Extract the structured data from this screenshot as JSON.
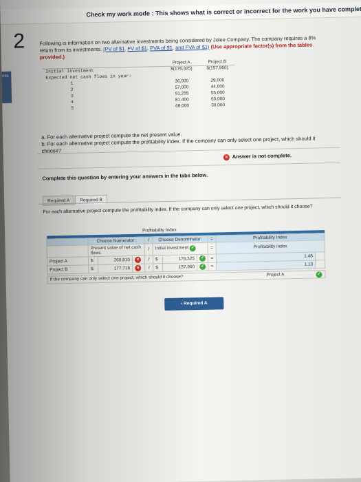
{
  "banner": {
    "text": "Check my work mode : This shows what is correct or incorrect for the work you have completed so far. It does not i"
  },
  "question": {
    "number": "2",
    "side_tab": "ints",
    "intro_text": "Following is information on two alternative investments being considered by Jolee Company. The company requires a 8% return from its investments.",
    "links": [
      "(PV of $1",
      "FV of $1",
      "PVA of $1",
      "and FVA of $1)"
    ],
    "instruction": "(Use appropriate factor(s) from the tables provided.)"
  },
  "investments": {
    "headers": [
      "",
      "Project A",
      "Project B"
    ],
    "rows": [
      {
        "label": "Initial investment",
        "a": "$(176,325)",
        "b": "$(157,960)"
      },
      {
        "label": "Expected net cash flows in year:",
        "a": "",
        "b": ""
      },
      {
        "label": "1",
        "a": "36,000",
        "b": "28,000"
      },
      {
        "label": "2",
        "a": "57,000",
        "b": "44,000"
      },
      {
        "label": "3",
        "a": "91,255",
        "b": "55,000"
      },
      {
        "label": "4",
        "a": "81,400",
        "b": "60,000"
      },
      {
        "label": "5",
        "a": "68,000",
        "b": "30,000"
      }
    ]
  },
  "parts": [
    "a. For each alternative project compute the net present value.",
    "b. For each alternative project compute the profitability index. If the company can only select one project, which should it choose?"
  ],
  "status": "Answer is not complete.",
  "complete_msg": "Complete this question by entering your answers in the tabs below.",
  "tabs": [
    {
      "label": "Required A",
      "active": false
    },
    {
      "label": "Required B",
      "active": true
    }
  ],
  "instructions_b": "For each alternative project compute the profitability index. If the company can only select one project, which should it choose?",
  "pi_table": {
    "title": "Profitability Index",
    "headers": [
      "Choose Numerator:",
      "/",
      "Choose Denominator:",
      "=",
      "Profitability Index"
    ],
    "subheaders": [
      "",
      "/",
      "",
      "=",
      "Profitability index"
    ],
    "row_labels_hdr": [
      "Present value of net cash flows",
      "/",
      "Initial investment",
      "=",
      "Profitability index"
    ],
    "rows": [
      {
        "project": "Project A",
        "dollar": "$",
        "num": "260,810",
        "num_status": "x",
        "slash": "/",
        "dollar2": "$",
        "den": "176,325",
        "den_status": "ok",
        "eq": "=",
        "pi": "1.48"
      },
      {
        "project": "Project B",
        "dollar": "$",
        "num": "177,716",
        "num_status": "x",
        "slash": "/",
        "dollar2": "$",
        "den": "157,960",
        "den_status": "ok",
        "eq": "=",
        "pi": "1.13"
      }
    ],
    "choice_question": "If the company can only select one project, which should it choose?",
    "choice_answer": "Project A"
  },
  "back_button": "Required A",
  "colors": {
    "accent": "#2e5f95",
    "error": "#d2342a",
    "success": "#45a845",
    "header_bg": "#cbe0ef"
  }
}
